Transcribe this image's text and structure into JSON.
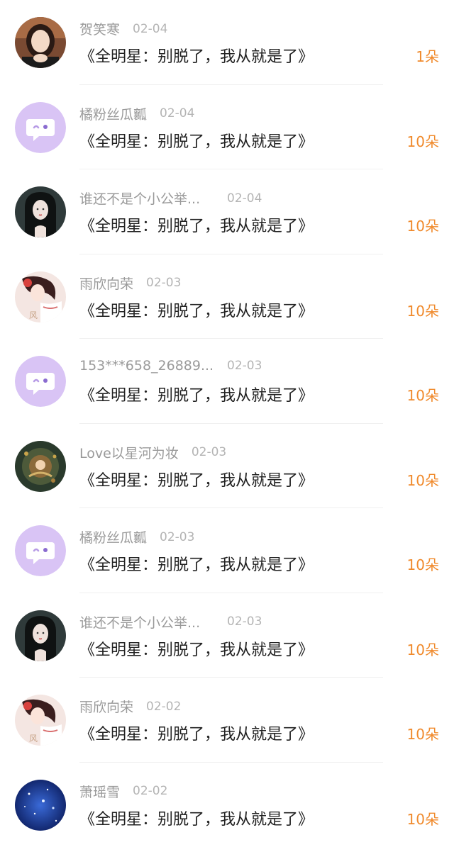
{
  "items": [
    {
      "name": "贺笑寒",
      "date": "02-04",
      "title": "《全明星：别脱了，我从就是了》",
      "count": "1朵",
      "avatar": "photo-woman-icon"
    },
    {
      "name": "橘粉丝瓜瓤",
      "date": "02-04",
      "title": "《全明星：别脱了，我从就是了》",
      "count": "10朵",
      "avatar": "default-chat-bubble-icon"
    },
    {
      "name": "谁还不是个小公举...",
      "date": "02-04",
      "title": "《全明星：别脱了，我从就是了》",
      "count": "10朵",
      "avatar": "dark-hair-woman-icon"
    },
    {
      "name": "雨欣向荣",
      "date": "02-03",
      "title": "《全明星：别脱了，我从就是了》",
      "count": "10朵",
      "avatar": "anime-girl-icon"
    },
    {
      "name": "153***658_26889...",
      "date": "02-03",
      "title": "《全明星：别脱了，我从就是了》",
      "count": "10朵",
      "avatar": "default-chat-bubble-icon"
    },
    {
      "name": "Love以星河为妆",
      "date": "02-03",
      "title": "《全明星：别脱了，我从就是了》",
      "count": "10朵",
      "avatar": "fantasy-art-icon"
    },
    {
      "name": "橘粉丝瓜瓤",
      "date": "02-03",
      "title": "《全明星：别脱了，我从就是了》",
      "count": "10朵",
      "avatar": "default-chat-bubble-icon"
    },
    {
      "name": "谁还不是个小公举...",
      "date": "02-03",
      "title": "《全明星：别脱了，我从就是了》",
      "count": "10朵",
      "avatar": "dark-hair-woman-icon"
    },
    {
      "name": "雨欣向荣",
      "date": "02-02",
      "title": "《全明星：别脱了，我从就是了》",
      "count": "10朵",
      "avatar": "anime-girl-icon"
    },
    {
      "name": "萧瑶雪",
      "date": "02-02",
      "title": "《全明星：别脱了，我从就是了》",
      "count": "10朵",
      "avatar": "starry-sky-icon"
    }
  ],
  "colors": {
    "accent": "#f08a2c",
    "name": "#9a9a9a",
    "date": "#b4b4b4",
    "title": "#222222",
    "default_avatar": "#d9c4f5"
  }
}
